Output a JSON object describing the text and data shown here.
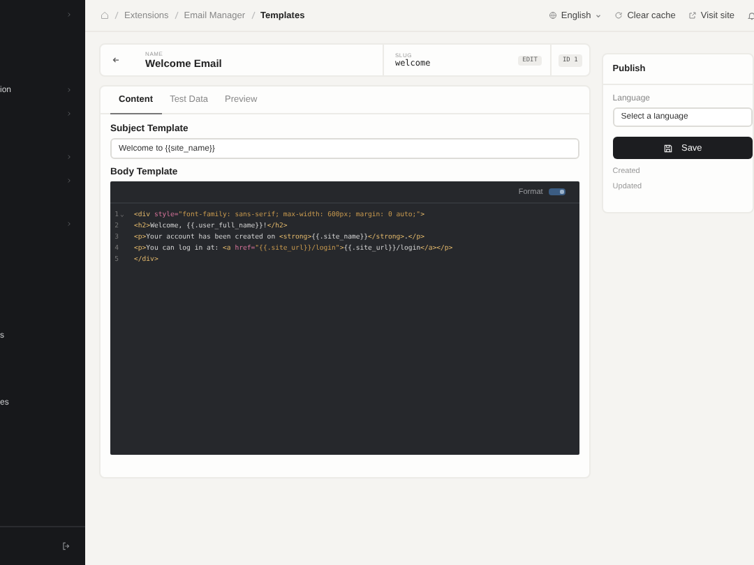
{
  "sidebar": {
    "items": [
      {
        "expandable": true
      },
      {
        "label": "ion",
        "expandable": true
      },
      {
        "expandable": true
      },
      {
        "expandable": true
      },
      {
        "expandable": true
      },
      {
        "expandable": true
      },
      {
        "label": "s",
        "expandable": false
      },
      {
        "label": "es",
        "expandable": false
      }
    ]
  },
  "breadcrumb": [
    "Extensions",
    "Email Manager",
    "Templates"
  ],
  "topbar": {
    "language": "English",
    "actions": [
      "Clear cache",
      "Visit site"
    ]
  },
  "header": {
    "name_label": "NAME",
    "name": "Welcome Email",
    "slug_label": "SLUG",
    "slug": "welcome",
    "edit": "EDIT",
    "id": "ID 1"
  },
  "tabs": [
    {
      "label": "Content",
      "selected": true
    },
    {
      "label": "Test Data",
      "selected": false
    },
    {
      "label": "Preview",
      "selected": false
    }
  ],
  "subject": {
    "label": "Subject Template",
    "value": "Welcome to {{site_name}}"
  },
  "body": {
    "label": "Body Template",
    "format": {
      "label": "Format",
      "on": true
    },
    "lines": [
      {
        "number": "1",
        "fold": "⌄",
        "tokens": [
          {
            "kind": "tag",
            "text": "<div "
          },
          {
            "kind": "attr",
            "text": "style="
          },
          {
            "kind": "string",
            "text": "\"font-family: sans-serif; max-width: 600px; margin: 0 auto;\""
          },
          {
            "kind": "tag",
            "text": ">"
          }
        ]
      },
      {
        "number": "2",
        "tokens": [
          {
            "kind": "tag",
            "text": "<h2>"
          },
          {
            "kind": "text",
            "text": "Welcome, {{.user_full_name}}!"
          },
          {
            "kind": "tag",
            "text": "</h2>"
          }
        ]
      },
      {
        "number": "3",
        "tokens": [
          {
            "kind": "tag",
            "text": "<p>"
          },
          {
            "kind": "text",
            "text": "Your account has been created on "
          },
          {
            "kind": "tag",
            "text": "<strong>"
          },
          {
            "kind": "text",
            "text": "{{.site_name}}"
          },
          {
            "kind": "tag",
            "text": "</strong>"
          },
          {
            "kind": "text",
            "text": "."
          },
          {
            "kind": "tag",
            "text": "</p>"
          }
        ]
      },
      {
        "number": "4",
        "tokens": [
          {
            "kind": "tag",
            "text": "<p>"
          },
          {
            "kind": "text",
            "text": "You can log in at: "
          },
          {
            "kind": "tag",
            "text": "<a "
          },
          {
            "kind": "attr",
            "text": "href="
          },
          {
            "kind": "string",
            "text": "\"{{.site_url}}/login\""
          },
          {
            "kind": "tag",
            "text": ">"
          },
          {
            "kind": "text",
            "text": "{{.site_url}}/login"
          },
          {
            "kind": "tag",
            "text": "</a></p>"
          }
        ]
      },
      {
        "number": "5",
        "tokens": [
          {
            "kind": "tag",
            "text": "</div>"
          }
        ]
      }
    ]
  },
  "publish": {
    "title": "Publish",
    "language_label": "Language",
    "language_placeholder": "Select a language",
    "save": "Save",
    "meta": [
      "Created",
      "Updated"
    ]
  }
}
